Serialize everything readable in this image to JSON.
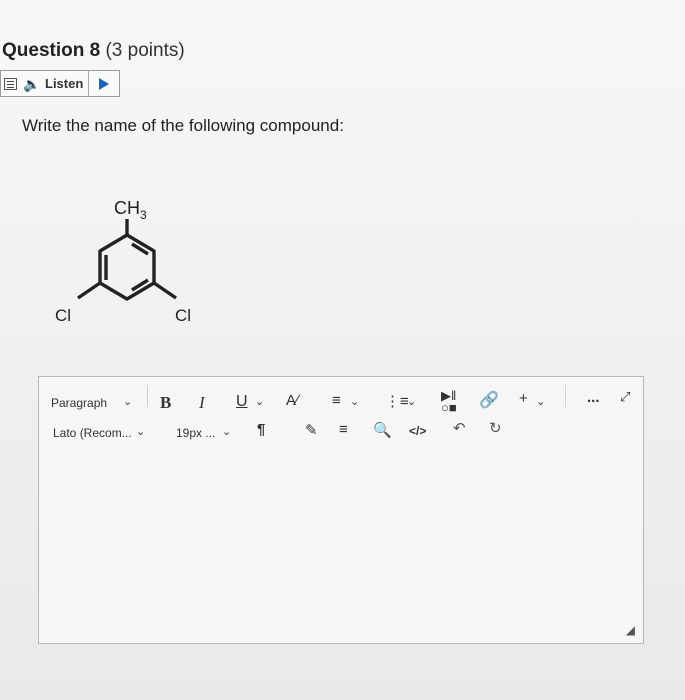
{
  "question": {
    "title": "Question 8",
    "points": "(3 points)"
  },
  "listen": {
    "label": "Listen",
    "speaker_icon": "speaker-icon",
    "play_icon": "play-icon"
  },
  "prompt": "Write the name of the following compound:",
  "molecule": {
    "top_label": "CH3",
    "top_label_main": "CH",
    "top_label_sub": "3",
    "left_label": "Cl",
    "right_label": "Cl"
  },
  "toolbar": {
    "block_format": "Paragraph",
    "font_family": "Lato (Recom...",
    "font_size": "19px ...",
    "bold": "B",
    "italic": "I",
    "underline": "U",
    "more": "+",
    "overflow": "..."
  },
  "editor": {
    "content": ""
  }
}
